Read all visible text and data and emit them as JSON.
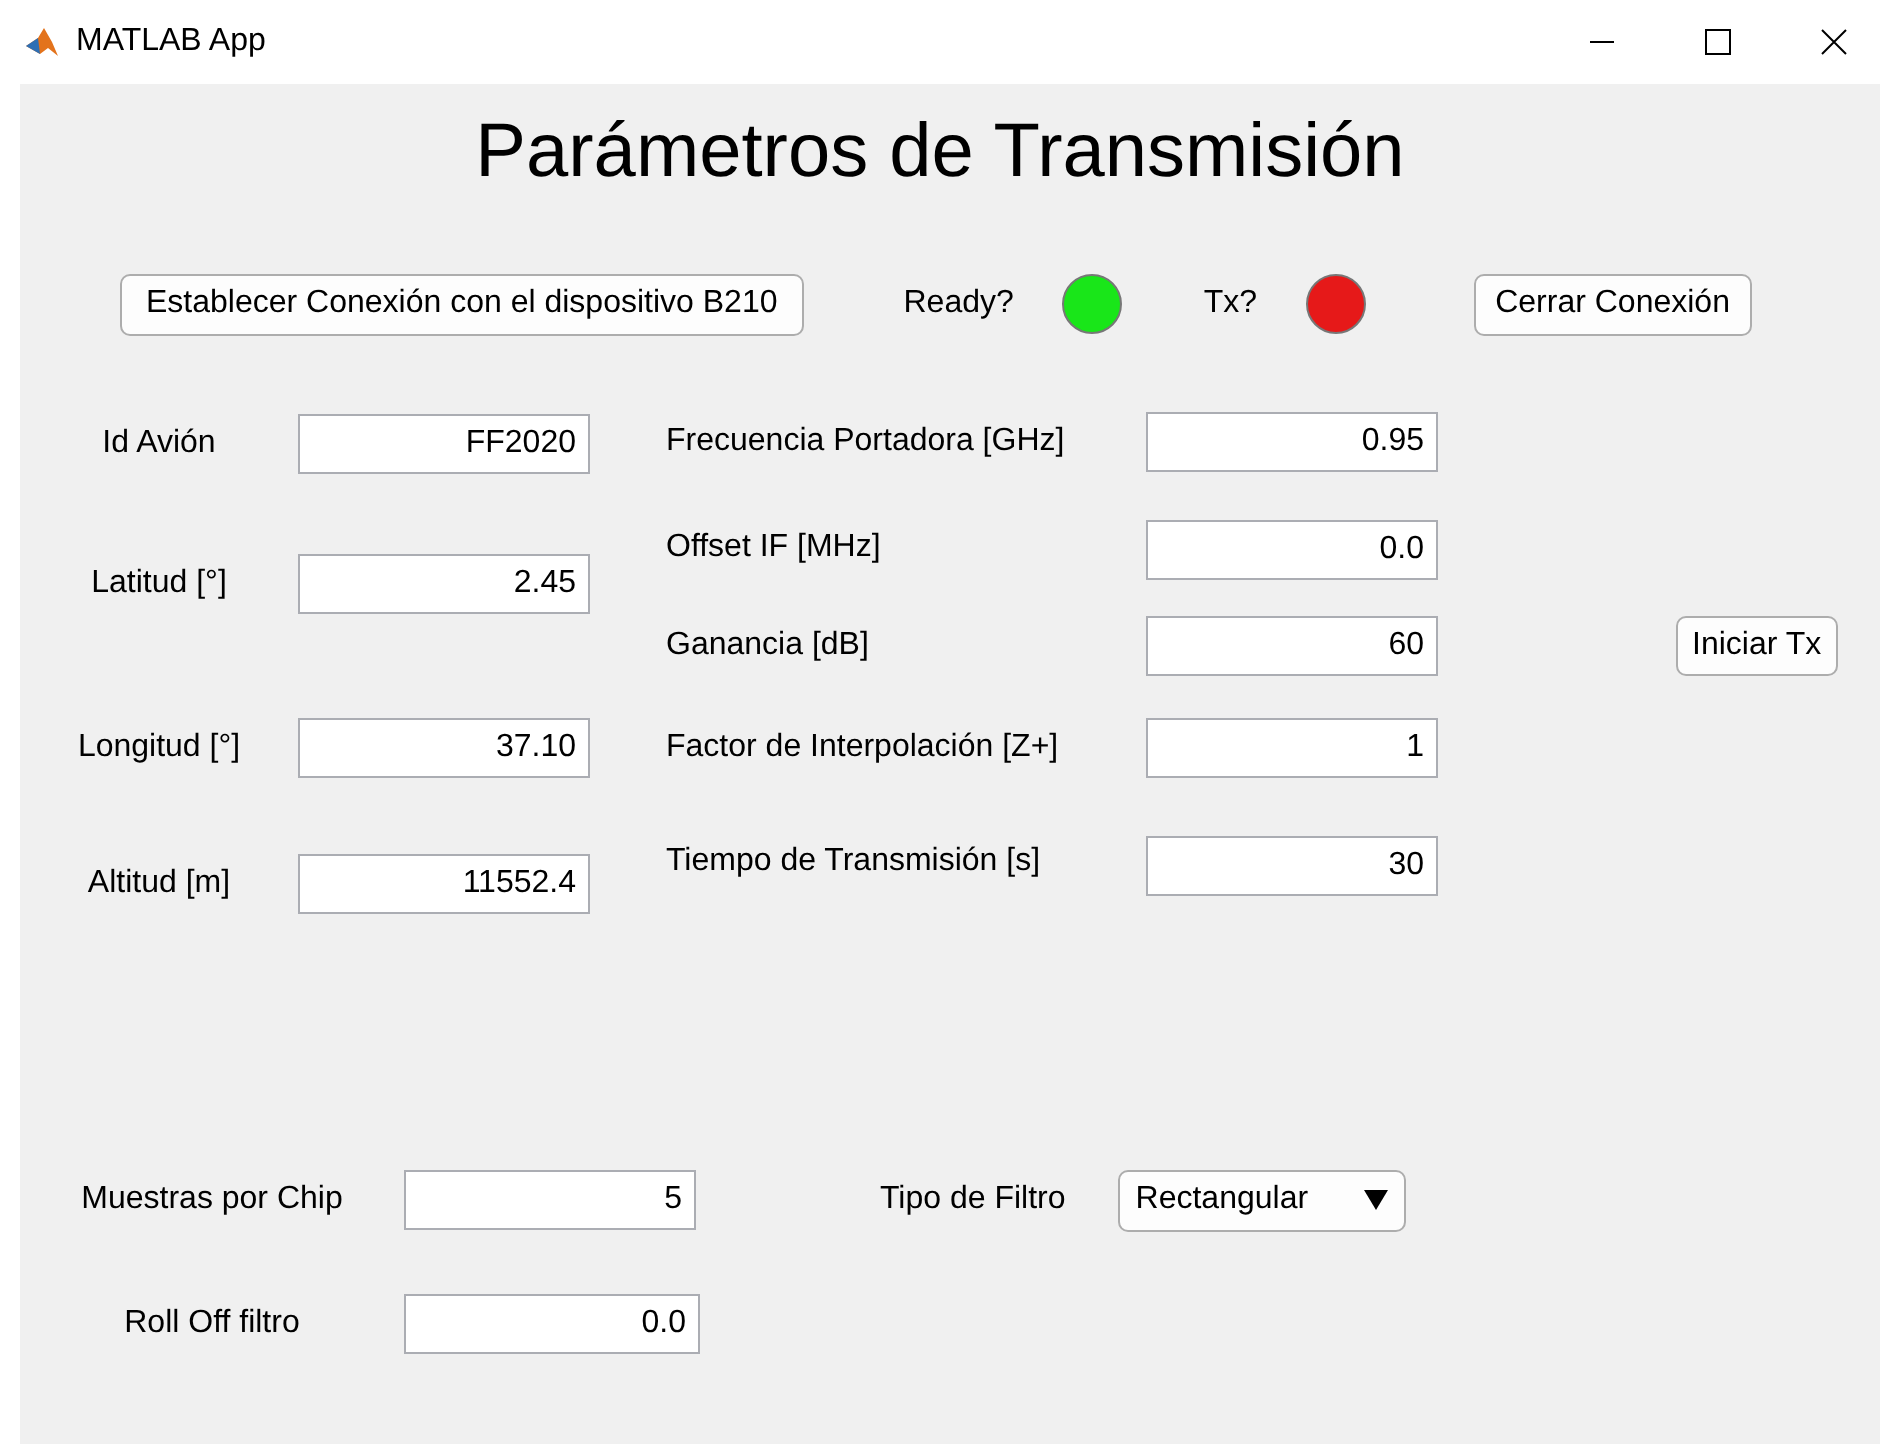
{
  "window": {
    "title": "MATLAB App"
  },
  "heading": "Parámetros de Transmisión",
  "connect_button": "Establecer Conexión con el dispositivo B210",
  "indicators": [
    {
      "label": "Ready?",
      "color": "#19e619"
    },
    {
      "label": "Tx?",
      "color": "#e61919"
    }
  ],
  "close_button": "Cerrar Conexión",
  "aircraft_fields": [
    {
      "label": "Id Avión",
      "value": "FF2020"
    },
    {
      "label": "Latitud [°]",
      "value": "2.45"
    },
    {
      "label": "Longitud [°]",
      "value": "37.10"
    },
    {
      "label": "Altitud [m]",
      "value": "11552.4"
    }
  ],
  "transmission_fields": [
    {
      "label": "Frecuencia Portadora [GHz]",
      "value": "0.95"
    },
    {
      "label": "Offset IF [MHz]",
      "value": "0.0"
    },
    {
      "label": "Ganancia [dB]",
      "value": "60"
    },
    {
      "label": "Factor de Interpolación [Z+]",
      "value": "1"
    },
    {
      "label": "Tiempo de Transmisión [s]",
      "value": "30"
    }
  ],
  "start_button": "Iniciar Tx",
  "filter": {
    "samples_label": "Muestras por Chip",
    "samples": "5",
    "type_label": "Tipo de Filtro",
    "type": "Rectangular",
    "rolloff_label": "Roll Off filtro",
    "rolloff": "0.0"
  }
}
